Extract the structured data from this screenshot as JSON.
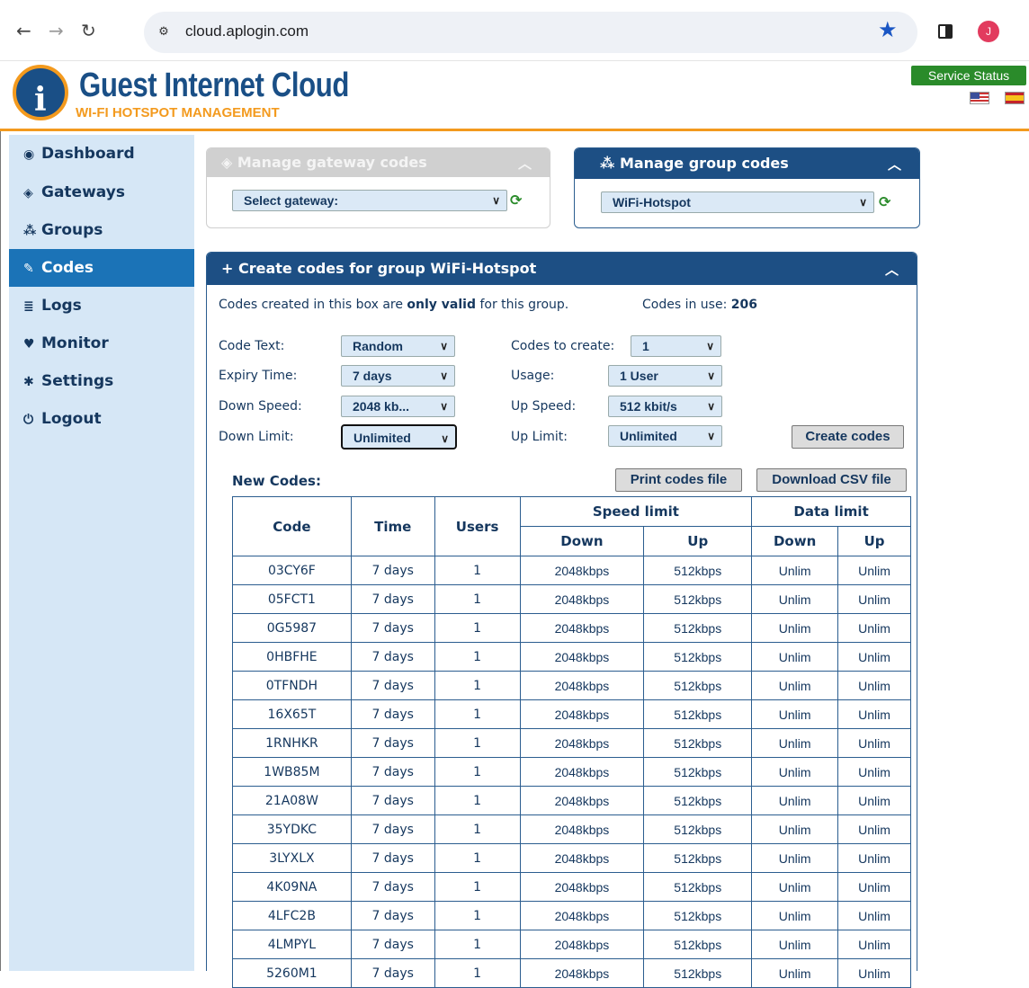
{
  "browser": {
    "url": "cloud.aplogin.com",
    "avatar_letter": "J",
    "icons": [
      "back-arrow-icon",
      "forward-arrow-icon",
      "reload-icon",
      "site-info-icon",
      "bookmark-star-icon",
      "side-panel-icon",
      "menu-icon"
    ]
  },
  "header": {
    "brand_title": "Guest Internet Cloud",
    "brand_subtitle": "WI-FI HOTSPOT MANAGEMENT",
    "service_status": "Service Status",
    "colors": {
      "brand_blue": "#1a4f86",
      "brand_orange": "#f39a1e",
      "status_green": "#2a8b2a"
    }
  },
  "sidebar": {
    "items": [
      {
        "label": "Dashboard",
        "icon": "tachometer-icon"
      },
      {
        "label": "Gateways",
        "icon": "cube-icon"
      },
      {
        "label": "Groups",
        "icon": "cubes-icon"
      },
      {
        "label": "Codes",
        "icon": "ticket-icon",
        "active": true
      },
      {
        "label": "Logs",
        "icon": "database-icon"
      },
      {
        "label": "Monitor",
        "icon": "heartbeat-icon"
      },
      {
        "label": "Settings",
        "icon": "cog-icon"
      },
      {
        "label": "Logout",
        "icon": "power-icon"
      }
    ]
  },
  "gateway_box": {
    "title": "Manage gateway codes",
    "select_value": "Select gateway:"
  },
  "group_box": {
    "title": "Manage group codes",
    "select_value": "WiFi-Hotspot"
  },
  "create_box": {
    "title": "Create codes for group WiFi-Hotspot",
    "notice_pre": "Codes created in this box are",
    "notice_bold": "only valid",
    "notice_post": "for this group.",
    "codes_in_use_label": "Codes in use:",
    "codes_in_use_value": "206",
    "fields": {
      "code_text_label": "Code Text:",
      "code_text_value": "Random",
      "expiry_label": "Expiry Time:",
      "expiry_value": "7 days",
      "down_speed_label": "Down Speed:",
      "down_speed_value": "2048 kb...",
      "down_limit_label": "Down Limit:",
      "down_limit_value": "Unlimited",
      "codes_to_create_label": "Codes to create:",
      "codes_to_create_value": "1",
      "usage_label": "Usage:",
      "usage_value": "1 User",
      "up_speed_label": "Up Speed:",
      "up_speed_value": "512 kbit/s",
      "up_limit_label": "Up Limit:",
      "up_limit_value": "Unlimited"
    },
    "create_button": "Create codes",
    "new_codes_label": "New Codes:",
    "print_button": "Print codes file",
    "download_button": "Download CSV file"
  },
  "table": {
    "headers": {
      "code": "Code",
      "time": "Time",
      "users": "Users",
      "speed_limit": "Speed limit",
      "data_limit": "Data limit",
      "down": "Down",
      "up": "Up"
    },
    "rows": [
      [
        "03CY6F",
        "7 days",
        "1",
        "2048kbps",
        "512kbps",
        "Unlim",
        "Unlim"
      ],
      [
        "05FCT1",
        "7 days",
        "1",
        "2048kbps",
        "512kbps",
        "Unlim",
        "Unlim"
      ],
      [
        "0G5987",
        "7 days",
        "1",
        "2048kbps",
        "512kbps",
        "Unlim",
        "Unlim"
      ],
      [
        "0HBFHE",
        "7 days",
        "1",
        "2048kbps",
        "512kbps",
        "Unlim",
        "Unlim"
      ],
      [
        "0TFNDH",
        "7 days",
        "1",
        "2048kbps",
        "512kbps",
        "Unlim",
        "Unlim"
      ],
      [
        "16X65T",
        "7 days",
        "1",
        "2048kbps",
        "512kbps",
        "Unlim",
        "Unlim"
      ],
      [
        "1RNHKR",
        "7 days",
        "1",
        "2048kbps",
        "512kbps",
        "Unlim",
        "Unlim"
      ],
      [
        "1WB85M",
        "7 days",
        "1",
        "2048kbps",
        "512kbps",
        "Unlim",
        "Unlim"
      ],
      [
        "21A08W",
        "7 days",
        "1",
        "2048kbps",
        "512kbps",
        "Unlim",
        "Unlim"
      ],
      [
        "35YDKC",
        "7 days",
        "1",
        "2048kbps",
        "512kbps",
        "Unlim",
        "Unlim"
      ],
      [
        "3LYXLX",
        "7 days",
        "1",
        "2048kbps",
        "512kbps",
        "Unlim",
        "Unlim"
      ],
      [
        "4K09NA",
        "7 days",
        "1",
        "2048kbps",
        "512kbps",
        "Unlim",
        "Unlim"
      ],
      [
        "4LFC2B",
        "7 days",
        "1",
        "2048kbps",
        "512kbps",
        "Unlim",
        "Unlim"
      ],
      [
        "4LMPYL",
        "7 days",
        "1",
        "2048kbps",
        "512kbps",
        "Unlim",
        "Unlim"
      ],
      [
        "5260M1",
        "7 days",
        "1",
        "2048kbps",
        "512kbps",
        "Unlim",
        "Unlim"
      ]
    ]
  }
}
